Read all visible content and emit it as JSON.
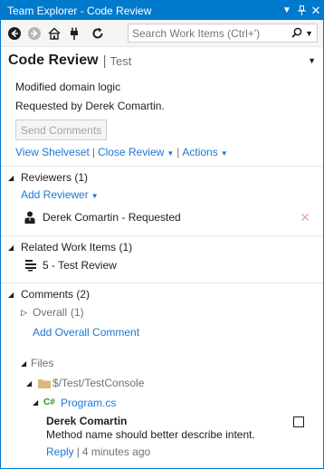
{
  "window": {
    "title": "Team Explorer - Code Review"
  },
  "toolbar": {
    "icons": [
      "back-arrow-icon",
      "forward-arrow-icon",
      "home-icon",
      "connect-plug-icon",
      "refresh-icon"
    ],
    "search_placeholder": "Search Work Items (Ctrl+')"
  },
  "header": {
    "title": "Code Review",
    "crumb": "Test"
  },
  "review": {
    "description": "Modified domain logic",
    "requested_by": "Requested by Derek Comartin.",
    "send_label": "Send Comments",
    "view_shelveset": "View Shelveset",
    "close_review": "Close Review",
    "actions": "Actions"
  },
  "reviewers": {
    "title": "Reviewers (1)",
    "add_label": "Add Reviewer",
    "items": [
      {
        "name": "Derek Comartin - Requested"
      }
    ]
  },
  "related": {
    "title": "Related Work Items (1)",
    "items": [
      {
        "label": "5 - Test Review"
      }
    ]
  },
  "comments": {
    "title": "Comments (2)",
    "overall_label": "Overall",
    "overall_count": "(1)",
    "add_overall": "Add Overall Comment",
    "files_label": "Files",
    "folder": "$/Test/TestConsole",
    "file": "Program.cs",
    "file_badge": "C#",
    "comment": {
      "author": "Derek Comartin",
      "text": "Method name should better describe intent.",
      "reply": "Reply",
      "time": "4 minutes ago"
    }
  },
  "colors": {
    "accent": "#007acc",
    "link": "#1e77d3",
    "folder": "#dcb67a",
    "csharp": "#388a34"
  }
}
